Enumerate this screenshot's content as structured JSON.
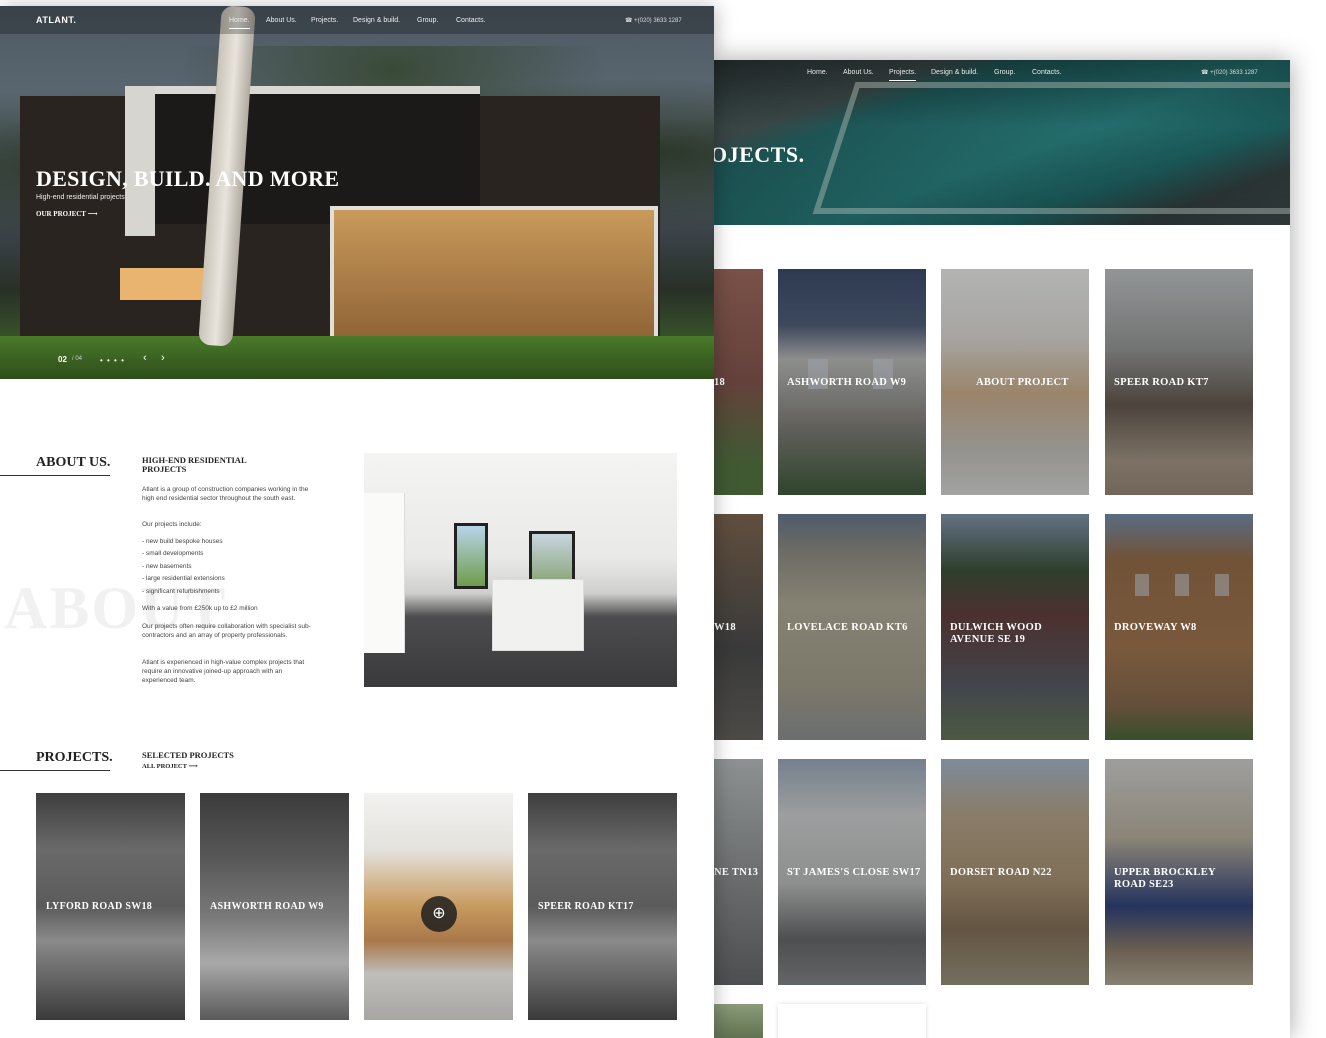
{
  "projects_page": {
    "nav": [
      "Home.",
      "About Us.",
      "Projects.",
      "Design & build.",
      "Group.",
      "Contacts."
    ],
    "phone": "+(020) 3633 1287",
    "title": "OJECTS.",
    "tiles": [
      {
        "label": "18"
      },
      {
        "label": "ASHWORTH ROAD W9"
      },
      {
        "label": "ABOUT PROJECT"
      },
      {
        "label": "SPEER ROAD KT7"
      },
      {
        "label": "W18"
      },
      {
        "label": "LOVELACE ROAD KT6"
      },
      {
        "label": "DULWICH WOOD AVENUE SE 19"
      },
      {
        "label": "DROVEWAY W8"
      },
      {
        "label": "NE TN13"
      },
      {
        "label": "ST JAMES'S CLOSE SW17"
      },
      {
        "label": "DORSET ROAD N22"
      },
      {
        "label": "UPPER BROCKLEY ROAD SE23"
      }
    ]
  },
  "home_page": {
    "logo": "ATLANT.",
    "nav": [
      "Home.",
      "About Us.",
      "Projects.",
      "Design & build.",
      "Group.",
      "Contacts."
    ],
    "phone": "+(020) 3633 1287",
    "hero": {
      "title": "DESIGN, BUILD. AND MORE",
      "subtitle": "High-end residential projects",
      "cta": "OUR PROJECT ⟶",
      "slide_current": "02",
      "slide_total": "/ 04",
      "dots": "• • • •",
      "prev": "‹",
      "next": "›"
    },
    "about": {
      "heading": "ABOUT US.",
      "bg_word": "ABOUT",
      "subheading": "HIGH-END RESIDENTIAL PROJECTS",
      "p1": "Atlant is a group of construction companies working in the high end residential sector throughout the south east.",
      "p2": "Our projects include:",
      "list": [
        "- new build bespoke houses",
        "- small developments",
        "- new basements",
        "- large residential extensions",
        "- significant refurbishments"
      ],
      "p3": "With a value from £250k up to £2 million",
      "p4": "Our projects often require collaboration with specialist sub-contractors and an array of property professionals.",
      "p5": "Atlant is experienced in high-value complex projects that require an innovative joined-up approach with an experienced team."
    },
    "projects": {
      "heading": "PROJECTS.",
      "subheading": "SELECTED PROJECTS",
      "all_link": "ALL PROJECT ⟶",
      "tiles": [
        {
          "label": "LYFORD ROAD SW18"
        },
        {
          "label": "ASHWORTH ROAD W9"
        },
        {
          "label": ""
        },
        {
          "label": "SPEER ROAD KT17"
        }
      ],
      "zoom_icon": "⊕"
    }
  }
}
